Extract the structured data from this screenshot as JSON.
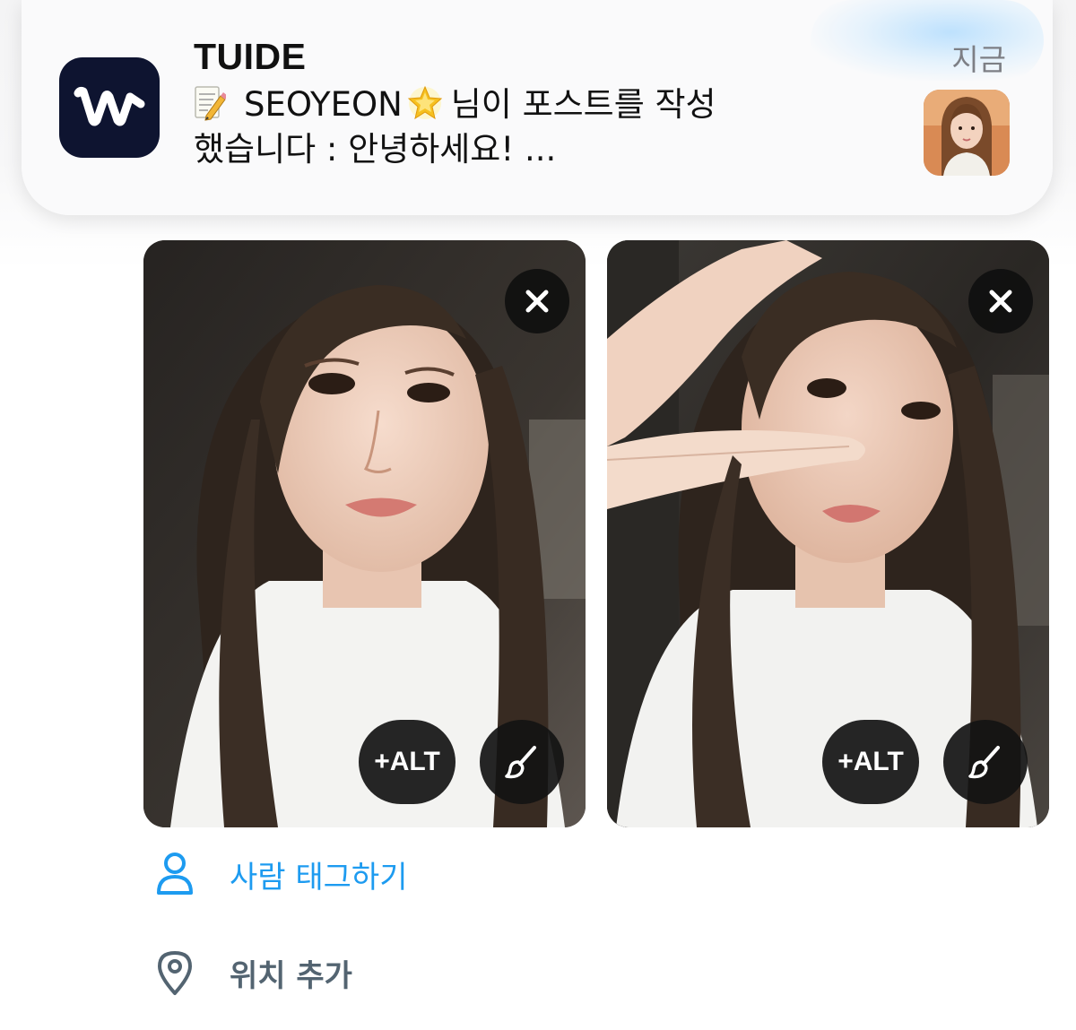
{
  "notification": {
    "app_name": "TUIDE",
    "time": "지금",
    "body_line1_name": "SEOYEON",
    "body_line1_rest": "님이 포스트를 작성",
    "body_line2": "했습니다 : 안녕하세요! ...",
    "icons": {
      "app": "weverse-logo-icon",
      "memo": "memo-emoji-icon",
      "star": "glowing-star-emoji-icon",
      "thumbnail": "profile-thumbnail"
    }
  },
  "media": {
    "photos": [
      {
        "alt_label": "+ALT",
        "remove_icon": "close-icon",
        "edit_icon": "brush-icon"
      },
      {
        "alt_label": "+ALT",
        "remove_icon": "close-icon",
        "edit_icon": "brush-icon"
      }
    ]
  },
  "actions": {
    "tag_people": {
      "label": "사람 태그하기",
      "icon": "person-icon"
    },
    "add_location": {
      "label": "위치 추가",
      "icon": "location-pin-icon"
    }
  },
  "colors": {
    "accent": "#1d9bf0",
    "secondary_text": "#536471",
    "app_icon_bg": "#0e1430",
    "overlay_button": "#141414"
  }
}
